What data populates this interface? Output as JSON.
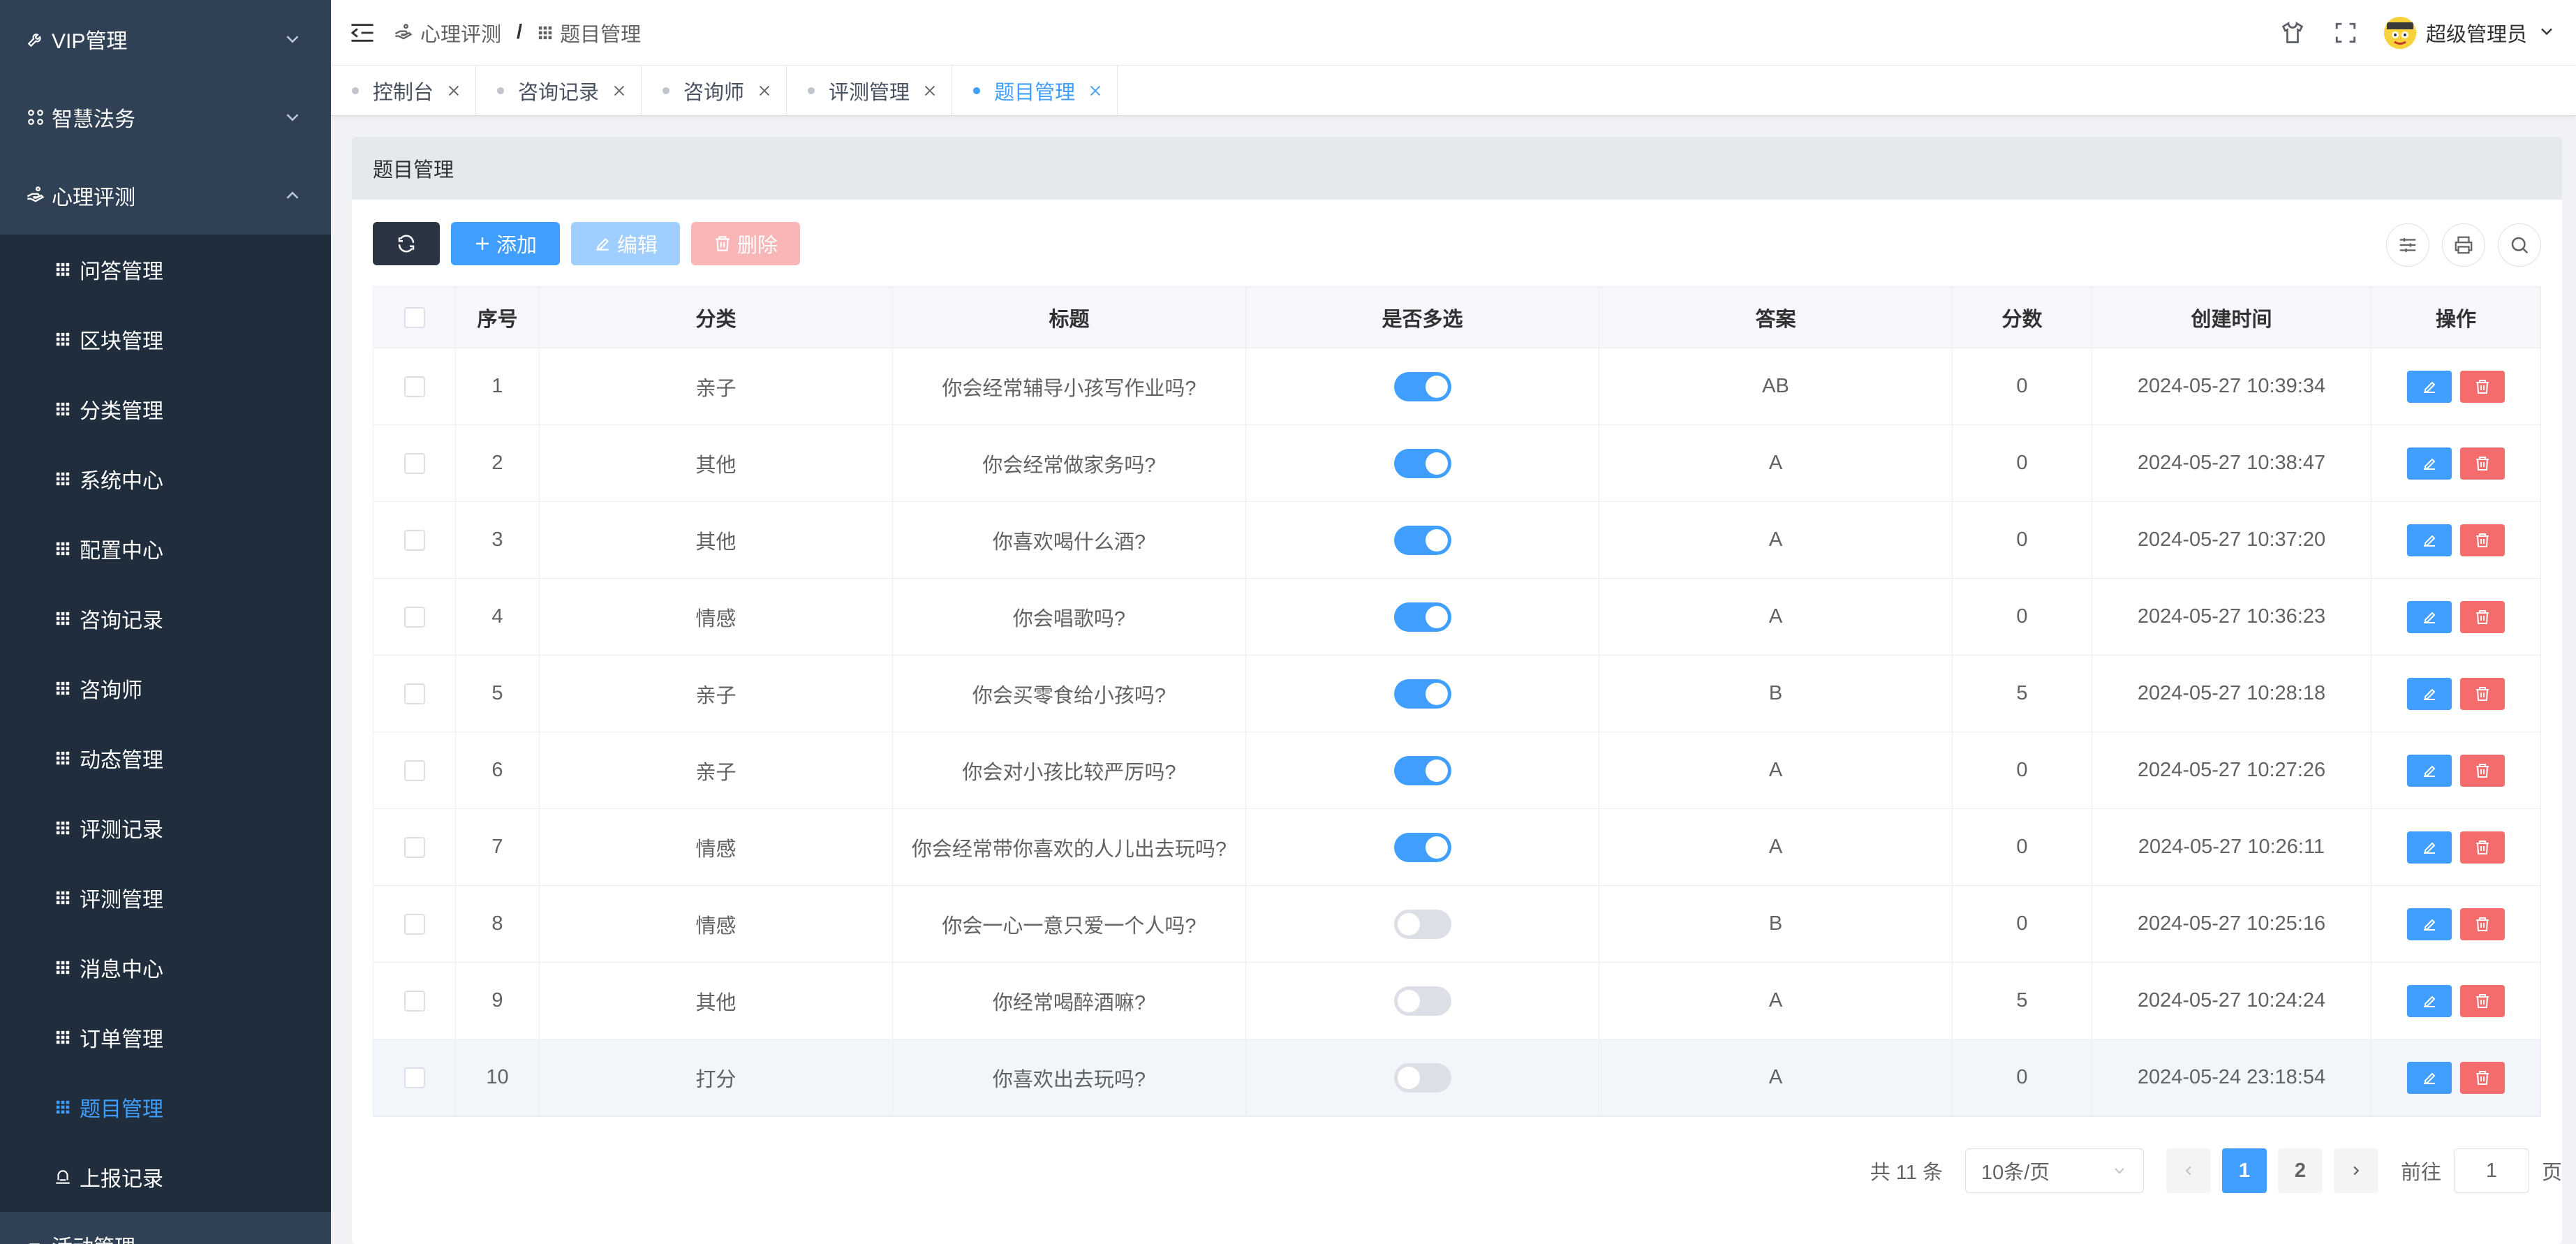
{
  "sidebar": {
    "top_items": [
      {
        "label": "VIP管理",
        "icon": "wrench-icon",
        "expanded": false
      },
      {
        "label": "智慧法务",
        "icon": "apps-icon",
        "expanded": false
      },
      {
        "label": "心理评测",
        "icon": "hand-icon",
        "expanded": true
      }
    ],
    "sub_items": [
      {
        "label": "问答管理",
        "icon": "grid-icon"
      },
      {
        "label": "区块管理",
        "icon": "grid-icon"
      },
      {
        "label": "分类管理",
        "icon": "grid-icon"
      },
      {
        "label": "系统中心",
        "icon": "grid-icon"
      },
      {
        "label": "配置中心",
        "icon": "grid-icon"
      },
      {
        "label": "咨询记录",
        "icon": "grid-icon"
      },
      {
        "label": "咨询师",
        "icon": "grid-icon"
      },
      {
        "label": "动态管理",
        "icon": "grid-icon"
      },
      {
        "label": "评测记录",
        "icon": "grid-icon"
      },
      {
        "label": "评测管理",
        "icon": "grid-icon"
      },
      {
        "label": "消息中心",
        "icon": "grid-icon"
      },
      {
        "label": "订单管理",
        "icon": "grid-icon"
      },
      {
        "label": "题目管理",
        "icon": "grid-icon",
        "active": true
      },
      {
        "label": "上报记录",
        "icon": "bell-icon"
      }
    ],
    "bottom_item": {
      "label": "活动管理",
      "icon": "flag-icon"
    }
  },
  "navbar": {
    "breadcrumb": [
      {
        "label": "心理评测",
        "icon": "hand-icon"
      },
      {
        "label": "题目管理",
        "icon": "grid-icon"
      }
    ],
    "separator": "/",
    "username": "超级管理员"
  },
  "tags": [
    {
      "label": "控制台",
      "active": false
    },
    {
      "label": "咨询记录",
      "active": false
    },
    {
      "label": "咨询师",
      "active": false
    },
    {
      "label": "评测管理",
      "active": false
    },
    {
      "label": "题目管理",
      "active": true
    }
  ],
  "card": {
    "title": "题目管理"
  },
  "toolbar": {
    "add_label": "添加",
    "edit_label": "编辑",
    "delete_label": "删除"
  },
  "table": {
    "columns": [
      "序号",
      "分类",
      "标题",
      "是否多选",
      "答案",
      "分数",
      "创建时间",
      "操作"
    ],
    "rows": [
      {
        "no": "1",
        "category": "亲子",
        "title": "你会经常辅导小孩写作业吗?",
        "multi": true,
        "answer": "AB",
        "score": "0",
        "created": "2024-05-27 10:39:34"
      },
      {
        "no": "2",
        "category": "其他",
        "title": "你会经常做家务吗?",
        "multi": true,
        "answer": "A",
        "score": "0",
        "created": "2024-05-27 10:38:47"
      },
      {
        "no": "3",
        "category": "其他",
        "title": "你喜欢喝什么酒?",
        "multi": true,
        "answer": "A",
        "score": "0",
        "created": "2024-05-27 10:37:20"
      },
      {
        "no": "4",
        "category": "情感",
        "title": "你会唱歌吗?",
        "multi": true,
        "answer": "A",
        "score": "0",
        "created": "2024-05-27 10:36:23"
      },
      {
        "no": "5",
        "category": "亲子",
        "title": "你会买零食给小孩吗?",
        "multi": true,
        "answer": "B",
        "score": "5",
        "created": "2024-05-27 10:28:18"
      },
      {
        "no": "6",
        "category": "亲子",
        "title": "你会对小孩比较严厉吗?",
        "multi": true,
        "answer": "A",
        "score": "0",
        "created": "2024-05-27 10:27:26"
      },
      {
        "no": "7",
        "category": "情感",
        "title": "你会经常带你喜欢的人儿出去玩吗?",
        "multi": true,
        "answer": "A",
        "score": "0",
        "created": "2024-05-27 10:26:11"
      },
      {
        "no": "8",
        "category": "情感",
        "title": "你会一心一意只爱一个人吗?",
        "multi": false,
        "answer": "B",
        "score": "0",
        "created": "2024-05-27 10:25:16"
      },
      {
        "no": "9",
        "category": "其他",
        "title": "你经常喝醉酒嘛?",
        "multi": false,
        "answer": "A",
        "score": "5",
        "created": "2024-05-27 10:24:24"
      },
      {
        "no": "10",
        "category": "打分",
        "title": "你喜欢出去玩吗?",
        "multi": false,
        "answer": "A",
        "score": "0",
        "created": "2024-05-24 23:18:54"
      }
    ]
  },
  "pagination": {
    "total_text": "共 11 条",
    "page_size": "10条/页",
    "pages": [
      "1",
      "2"
    ],
    "current_page": "1",
    "goto_label": "前往",
    "goto_value": "1",
    "page_suffix": "页"
  },
  "colors": {
    "primary": "#409eff",
    "danger": "#f56c6c",
    "sidebar_bg": "#304156",
    "submenu_bg": "#1f2d3d"
  }
}
